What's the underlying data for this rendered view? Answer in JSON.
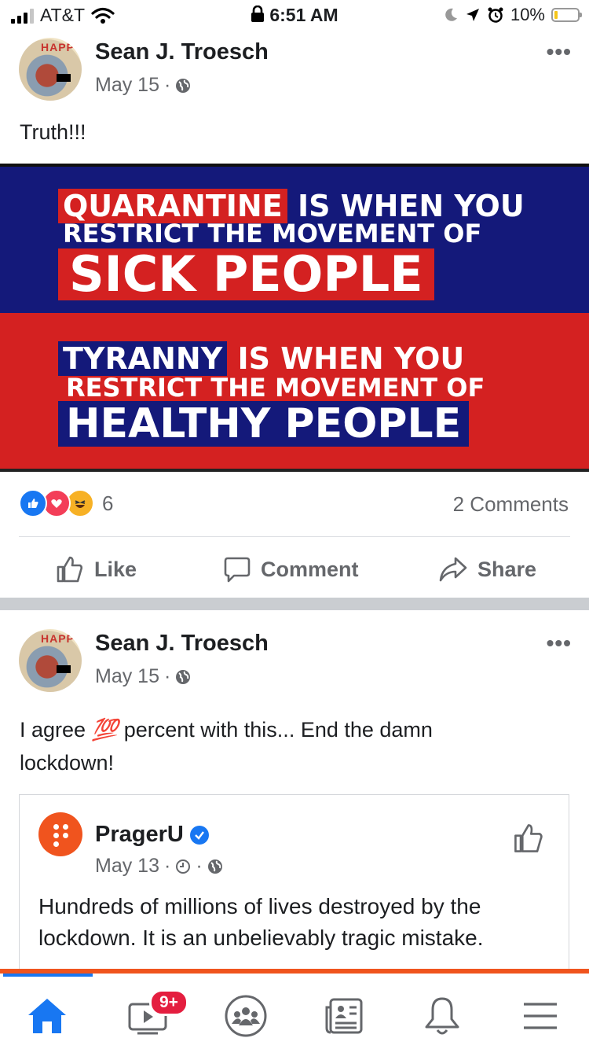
{
  "status_bar": {
    "carrier": "AT&T",
    "time": "6:51 AM",
    "battery": "10%"
  },
  "posts": [
    {
      "author": "Sean J. Troesch",
      "date": "May 15",
      "separator": "·",
      "text": "Truth!!!",
      "image": {
        "top_line1_highlight": "QUARANTINE",
        "top_line1_rest": "IS WHEN YOU",
        "top_line2": "RESTRICT THE MOVEMENT OF",
        "top_line3": "SICK PEOPLE",
        "bottom_line1_highlight": "TYRANNY",
        "bottom_line1_rest": "IS WHEN YOU",
        "bottom_line2": "RESTRICT THE MOVEMENT OF",
        "bottom_line3": "HEALTHY PEOPLE"
      },
      "reaction_count": "6",
      "comments": "2 Comments",
      "actions": {
        "like": "Like",
        "comment": "Comment",
        "share": "Share"
      }
    },
    {
      "author": "Sean J. Troesch",
      "date": "May 15",
      "separator": "·",
      "text_before": "I agree",
      "emoji": "💯",
      "text_after": "percent with this... End the damn",
      "text_line2": "lockdown!",
      "shared": {
        "page_name": "PragerU",
        "date": "May 13",
        "text": "Hundreds of millions of lives destroyed by the lockdown. It is an unbelievably tragic mistake."
      }
    }
  ],
  "tab_bar": {
    "video_badge": "9+",
    "tabs": [
      "home",
      "watch",
      "groups",
      "news",
      "notifications",
      "menu"
    ]
  },
  "colors": {
    "accent": "#1877f2",
    "meme_blue": "#14197a",
    "meme_red": "#d42121",
    "prager_orange": "#f0541e"
  }
}
